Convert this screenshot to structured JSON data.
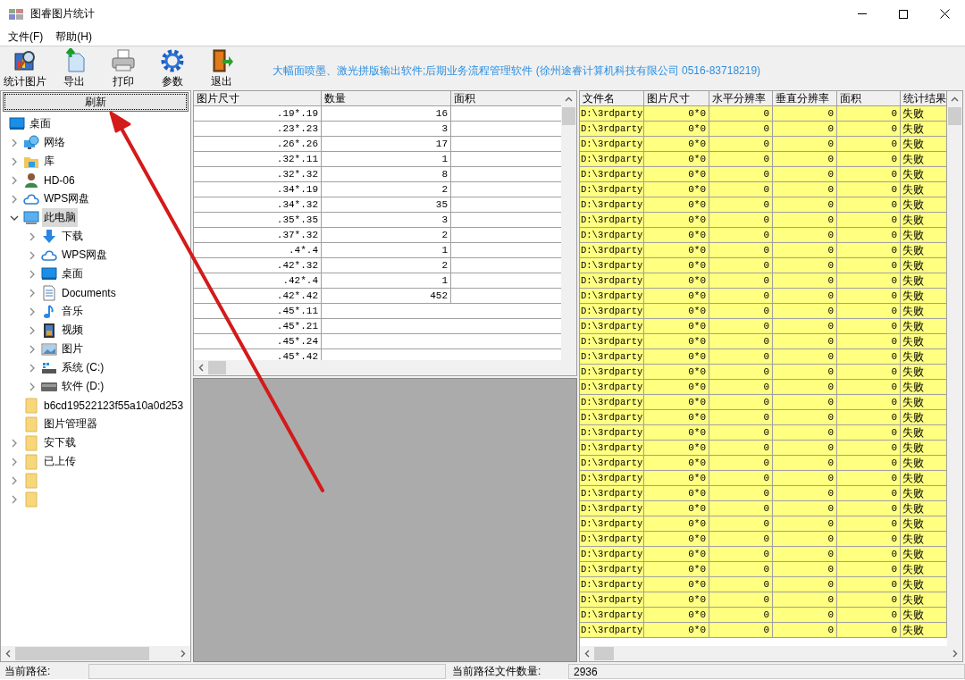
{
  "window": {
    "title": "图睿图片统计"
  },
  "menu": [
    {
      "label": "文件(F)"
    },
    {
      "label": "帮助(H)"
    }
  ],
  "toolbar": {
    "buttons": [
      {
        "label": "统计图片",
        "kind": "stats"
      },
      {
        "label": "导出",
        "kind": "export"
      },
      {
        "label": "打印",
        "kind": "print"
      },
      {
        "label": "参数",
        "kind": "settings"
      },
      {
        "label": "退出",
        "kind": "exit"
      }
    ],
    "banner": "大幅面喷墨、激光拼版输出软件;后期业务流程管理软件 (徐州途睿计算机科技有限公司 0516-83718219)"
  },
  "refresh_button": "刷新",
  "folder_tree": [
    {
      "label": "桌面",
      "kind": "desktop",
      "selected": false,
      "children": [
        {
          "label": "网络",
          "kind": "network",
          "selected": false,
          "expanded": false
        },
        {
          "label": "库",
          "kind": "library",
          "selected": false,
          "expanded": false
        },
        {
          "label": "HD-06",
          "kind": "user",
          "selected": false,
          "expanded": false
        },
        {
          "label": "WPS网盘",
          "kind": "cloud",
          "selected": false,
          "expanded": false
        },
        {
          "label": "此电脑",
          "kind": "computer",
          "selected": true,
          "expanded": true,
          "children": [
            {
              "label": "下载",
              "kind": "download",
              "selected": false,
              "expanded": false
            },
            {
              "label": "WPS网盘",
              "kind": "cloud",
              "selected": false,
              "expanded": false
            },
            {
              "label": "桌面",
              "kind": "desktop",
              "selected": false,
              "expanded": false
            },
            {
              "label": "Documents",
              "kind": "document",
              "selected": false,
              "expanded": false
            },
            {
              "label": "音乐",
              "kind": "music",
              "selected": false,
              "expanded": false
            },
            {
              "label": "视频",
              "kind": "video",
              "selected": false,
              "expanded": false
            },
            {
              "label": "图片",
              "kind": "picture",
              "selected": false,
              "expanded": false
            },
            {
              "label": "系统 (C:)",
              "kind": "system-drive",
              "selected": false,
              "expanded": false
            },
            {
              "label": "软件 (D:)",
              "kind": "drive",
              "selected": false,
              "expanded": false
            }
          ]
        },
        {
          "label": "b6cd19522123f55a10a0d253",
          "kind": "folder",
          "selected": false,
          "expandable": false
        },
        {
          "label": "图片管理器",
          "kind": "folder",
          "selected": false,
          "expandable": false
        },
        {
          "label": "安下载",
          "kind": "folder",
          "selected": false,
          "expanded": false
        },
        {
          "label": "已上传",
          "kind": "folder",
          "selected": false,
          "expanded": false
        },
        {
          "kind": "folder",
          "selected": false,
          "expanded": false
        },
        {
          "kind": "folder",
          "selected": false,
          "expanded": false
        }
      ]
    }
  ],
  "size_table": {
    "columns": [
      "图片尺寸",
      "数量",
      "面积"
    ],
    "rows": [
      {
        "size": ".19*.19",
        "count": "16"
      },
      {
        "size": ".23*.23",
        "count": "3"
      },
      {
        "size": ".26*.26",
        "count": "17"
      },
      {
        "size": ".32*.11",
        "count": "1"
      },
      {
        "size": ".32*.32",
        "count": "8"
      },
      {
        "size": ".34*.19",
        "count": "2"
      },
      {
        "size": ".34*.32",
        "count": "35"
      },
      {
        "size": ".35*.35",
        "count": "3"
      },
      {
        "size": ".37*.32",
        "count": "2"
      },
      {
        "size": ".4*.4",
        "count": "1"
      },
      {
        "size": ".42*.32",
        "count": "2"
      },
      {
        "size": ".42*.4",
        "count": "1"
      },
      {
        "size": ".42*.42",
        "count": "452"
      },
      {
        "size": ".45*.11"
      },
      {
        "size": ".45*.21"
      },
      {
        "size": ".45*.24"
      },
      {
        "size": ".45*.42"
      }
    ]
  },
  "file_table": {
    "columns": [
      "文件名",
      "图片尺寸",
      "水平分辨率",
      "垂直分辨率",
      "面积",
      "统计结果"
    ],
    "rows": [
      {
        "file": "D:\\3rdparty",
        "size": "0*0",
        "h_res": "0",
        "v_res": "0",
        "area": "0",
        "result": "失败"
      },
      {
        "file": "D:\\3rdparty",
        "size": "0*0",
        "h_res": "0",
        "v_res": "0",
        "area": "0",
        "result": "失败"
      },
      {
        "file": "D:\\3rdparty",
        "size": "0*0",
        "h_res": "0",
        "v_res": "0",
        "area": "0",
        "result": "失败"
      },
      {
        "file": "D:\\3rdparty",
        "size": "0*0",
        "h_res": "0",
        "v_res": "0",
        "area": "0",
        "result": "失败"
      },
      {
        "file": "D:\\3rdparty",
        "size": "0*0",
        "h_res": "0",
        "v_res": "0",
        "area": "0",
        "result": "失败"
      },
      {
        "file": "D:\\3rdparty",
        "size": "0*0",
        "h_res": "0",
        "v_res": "0",
        "area": "0",
        "result": "失败"
      },
      {
        "file": "D:\\3rdparty",
        "size": "0*0",
        "h_res": "0",
        "v_res": "0",
        "area": "0",
        "result": "失败"
      },
      {
        "file": "D:\\3rdparty",
        "size": "0*0",
        "h_res": "0",
        "v_res": "0",
        "area": "0",
        "result": "失败"
      },
      {
        "file": "D:\\3rdparty",
        "size": "0*0",
        "h_res": "0",
        "v_res": "0",
        "area": "0",
        "result": "失败"
      },
      {
        "file": "D:\\3rdparty",
        "size": "0*0",
        "h_res": "0",
        "v_res": "0",
        "area": "0",
        "result": "失败"
      },
      {
        "file": "D:\\3rdparty",
        "size": "0*0",
        "h_res": "0",
        "v_res": "0",
        "area": "0",
        "result": "失败"
      },
      {
        "file": "D:\\3rdparty",
        "size": "0*0",
        "h_res": "0",
        "v_res": "0",
        "area": "0",
        "result": "失败"
      },
      {
        "file": "D:\\3rdparty",
        "size": "0*0",
        "h_res": "0",
        "v_res": "0",
        "area": "0",
        "result": "失败"
      },
      {
        "file": "D:\\3rdparty",
        "size": "0*0",
        "h_res": "0",
        "v_res": "0",
        "area": "0",
        "result": "失败"
      },
      {
        "file": "D:\\3rdparty",
        "size": "0*0",
        "h_res": "0",
        "v_res": "0",
        "area": "0",
        "result": "失败"
      },
      {
        "file": "D:\\3rdparty",
        "size": "0*0",
        "h_res": "0",
        "v_res": "0",
        "area": "0",
        "result": "失败"
      },
      {
        "file": "D:\\3rdparty",
        "size": "0*0",
        "h_res": "0",
        "v_res": "0",
        "area": "0",
        "result": "失败"
      },
      {
        "file": "D:\\3rdparty",
        "size": "0*0",
        "h_res": "0",
        "v_res": "0",
        "area": "0",
        "result": "失败"
      },
      {
        "file": "D:\\3rdparty",
        "size": "0*0",
        "h_res": "0",
        "v_res": "0",
        "area": "0",
        "result": "失败"
      },
      {
        "file": "D:\\3rdparty",
        "size": "0*0",
        "h_res": "0",
        "v_res": "0",
        "area": "0",
        "result": "失败"
      },
      {
        "file": "D:\\3rdparty",
        "size": "0*0",
        "h_res": "0",
        "v_res": "0",
        "area": "0",
        "result": "失败"
      },
      {
        "file": "D:\\3rdparty",
        "size": "0*0",
        "h_res": "0",
        "v_res": "0",
        "area": "0",
        "result": "失败"
      },
      {
        "file": "D:\\3rdparty",
        "size": "0*0",
        "h_res": "0",
        "v_res": "0",
        "area": "0",
        "result": "失败"
      },
      {
        "file": "D:\\3rdparty",
        "size": "0*0",
        "h_res": "0",
        "v_res": "0",
        "area": "0",
        "result": "失败"
      },
      {
        "file": "D:\\3rdparty",
        "size": "0*0",
        "h_res": "0",
        "v_res": "0",
        "area": "0",
        "result": "失败"
      },
      {
        "file": "D:\\3rdparty",
        "size": "0*0",
        "h_res": "0",
        "v_res": "0",
        "area": "0",
        "result": "失败"
      },
      {
        "file": "D:\\3rdparty",
        "size": "0*0",
        "h_res": "0",
        "v_res": "0",
        "area": "0",
        "result": "失败"
      },
      {
        "file": "D:\\3rdparty",
        "size": "0*0",
        "h_res": "0",
        "v_res": "0",
        "area": "0",
        "result": "失败"
      },
      {
        "file": "D:\\3rdparty",
        "size": "0*0",
        "h_res": "0",
        "v_res": "0",
        "area": "0",
        "result": "失败"
      },
      {
        "file": "D:\\3rdparty",
        "size": "0*0",
        "h_res": "0",
        "v_res": "0",
        "area": "0",
        "result": "失败"
      },
      {
        "file": "D:\\3rdparty",
        "size": "0*0",
        "h_res": "0",
        "v_res": "0",
        "area": "0",
        "result": "失败"
      },
      {
        "file": "D:\\3rdparty",
        "size": "0*0",
        "h_res": "0",
        "v_res": "0",
        "area": "0",
        "result": "失败"
      },
      {
        "file": "D:\\3rdparty",
        "size": "0*0",
        "h_res": "0",
        "v_res": "0",
        "area": "0",
        "result": "失败"
      },
      {
        "file": "D:\\3rdparty",
        "size": "0*0",
        "h_res": "0",
        "v_res": "0",
        "area": "0",
        "result": "失败"
      },
      {
        "file": "D:\\3rdparty",
        "size": "0*0",
        "h_res": "0",
        "v_res": "0",
        "area": "0",
        "result": "失败"
      }
    ]
  },
  "status_bar": {
    "path_label": "当前路径:",
    "count_label": "当前路径文件数量:",
    "count": "2936"
  }
}
